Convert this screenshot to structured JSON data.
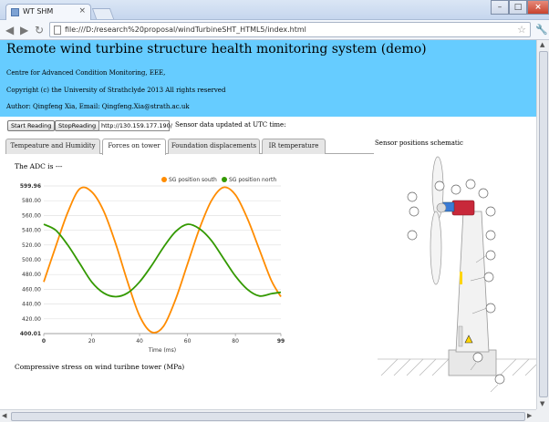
{
  "browser": {
    "tab_title": "WT SHM",
    "tab_close": "×",
    "url": "file:///D:/research%20proposal/windTurbineSHT_HTML5/index.html",
    "back_icon": "arrow-left-icon",
    "forward_icon": "arrow-right-icon",
    "reload_icon": "reload-icon",
    "star_icon": "star-icon",
    "wrench_icon": "wrench-icon"
  },
  "banner": {
    "title": "Remote wind turbine structure health monitoring system (demo)",
    "line1": "Centre for Advanced Condition Monitoring, EEE,",
    "line2": "Copyright (c) the University of Strathclyde 2013 All rights reserved",
    "line3": "Author: Qingfeng Xia, Email: Qingfeng.Xia@strath.ac.uk",
    "color": "#66ccff"
  },
  "controls": {
    "start_label": "Start Reading",
    "stop_label": "StopReading",
    "ip_value": "http://130.159.177.190/",
    "status_text": "Sensor data updated at UTC time:"
  },
  "tabs": [
    {
      "label": "Tempeature and Humidity",
      "active": false
    },
    {
      "label": "Forces on tower",
      "active": true
    },
    {
      "label": "Foundation displacements",
      "active": false
    },
    {
      "label": "IR temperature",
      "active": false
    }
  ],
  "adc_text": "The ADC is ---",
  "caption": "Compressive stress on wind turibne tower (MPa)",
  "schematic_title": "Sensor positions schematic",
  "chart_data": {
    "type": "line",
    "xlabel": "Time (ms)",
    "ylabel": "",
    "xlim": [
      0,
      99
    ],
    "ylim": [
      400.01,
      599.96
    ],
    "xticks": [
      "0",
      "20",
      "40",
      "60",
      "80",
      "99"
    ],
    "yticks": [
      "599.96",
      "580.00",
      "560.00",
      "540.00",
      "520.00",
      "500.00",
      "480.00",
      "460.00",
      "440.00",
      "420.00",
      "400.01"
    ],
    "legend_position": "top-right",
    "series": [
      {
        "name": "SG position south",
        "color": "#ff8c00",
        "x": [
          0,
          5,
          10,
          15,
          20,
          25,
          30,
          35,
          40,
          45,
          50,
          55,
          60,
          65,
          70,
          75,
          80,
          85,
          90,
          95,
          99
        ],
        "values": [
          470,
          518,
          564,
          596,
          592,
          566,
          522,
          470,
          424,
          402,
          410,
          446,
          494,
          542,
          580,
          598,
          588,
          556,
          514,
          472,
          450
        ]
      },
      {
        "name": "SG position north",
        "color": "#339900",
        "x": [
          0,
          5,
          10,
          15,
          20,
          25,
          30,
          35,
          40,
          45,
          50,
          55,
          60,
          65,
          70,
          75,
          80,
          85,
          90,
          95,
          99
        ],
        "values": [
          548,
          540,
          520,
          495,
          470,
          455,
          450,
          455,
          470,
          492,
          517,
          538,
          548,
          542,
          526,
          502,
          478,
          460,
          451,
          454,
          456
        ]
      }
    ]
  }
}
